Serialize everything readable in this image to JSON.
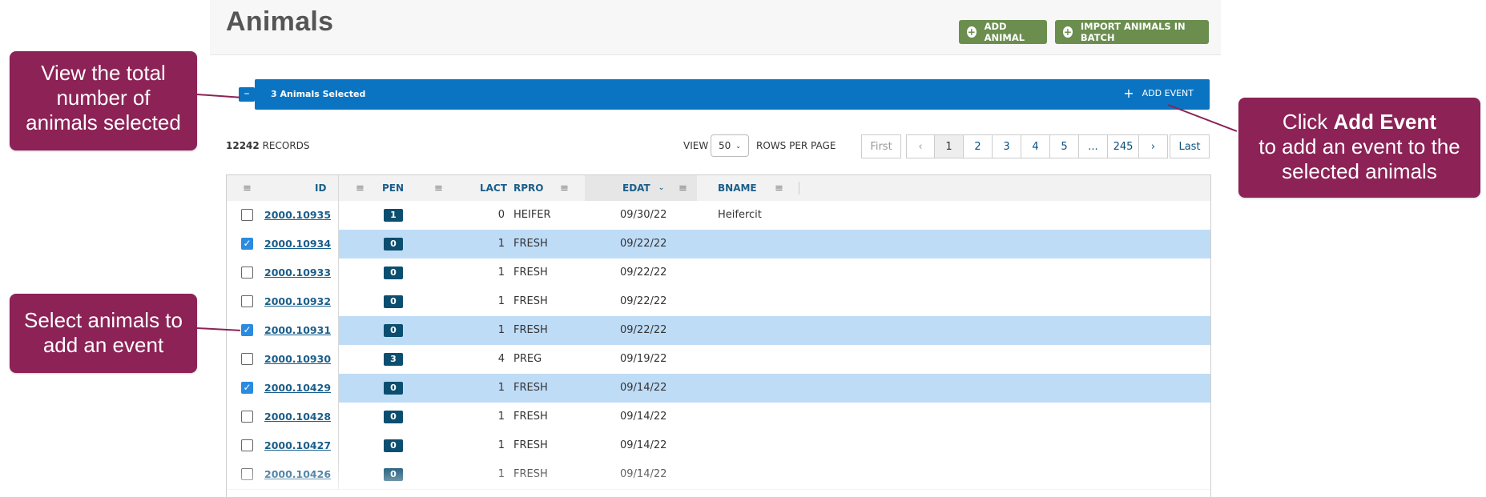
{
  "page": {
    "title": "Animals",
    "add_animal": "ADD ANIMAL",
    "import_batch": "IMPORT ANIMALS IN BATCH"
  },
  "selection": {
    "collapse": "–",
    "count_label": "3 Animals Selected",
    "add_event": "ADD EVENT"
  },
  "records": {
    "count": "12242",
    "label": "RECORDS"
  },
  "view": {
    "label": "VIEW",
    "rows": "50",
    "rows_label": "ROWS PER PAGE"
  },
  "pagination": {
    "first": "First",
    "prev": "‹",
    "pages": [
      "1",
      "2",
      "3",
      "4",
      "5",
      "...",
      "245"
    ],
    "next": "›",
    "last": "Last"
  },
  "columns": {
    "id": "ID",
    "pen": "PEN",
    "lact": "LACT",
    "rpro": "RPRO",
    "edat": "EDAT",
    "bname": "BNAME"
  },
  "rows": [
    {
      "id": "2000.10935",
      "pen": "1",
      "lact": "0",
      "rpro": "HEIFER",
      "edat": "09/30/22",
      "bname": "Heifercit",
      "selected": false
    },
    {
      "id": "2000.10934",
      "pen": "0",
      "lact": "1",
      "rpro": "FRESH",
      "edat": "09/22/22",
      "bname": "",
      "selected": true
    },
    {
      "id": "2000.10933",
      "pen": "0",
      "lact": "1",
      "rpro": "FRESH",
      "edat": "09/22/22",
      "bname": "",
      "selected": false
    },
    {
      "id": "2000.10932",
      "pen": "0",
      "lact": "1",
      "rpro": "FRESH",
      "edat": "09/22/22",
      "bname": "",
      "selected": false
    },
    {
      "id": "2000.10931",
      "pen": "0",
      "lact": "1",
      "rpro": "FRESH",
      "edat": "09/22/22",
      "bname": "",
      "selected": true
    },
    {
      "id": "2000.10930",
      "pen": "3",
      "lact": "4",
      "rpro": "PREG",
      "edat": "09/19/22",
      "bname": "",
      "selected": false
    },
    {
      "id": "2000.10429",
      "pen": "0",
      "lact": "1",
      "rpro": "FRESH",
      "edat": "09/14/22",
      "bname": "",
      "selected": true
    },
    {
      "id": "2000.10428",
      "pen": "0",
      "lact": "1",
      "rpro": "FRESH",
      "edat": "09/14/22",
      "bname": "",
      "selected": false
    },
    {
      "id": "2000.10427",
      "pen": "0",
      "lact": "1",
      "rpro": "FRESH",
      "edat": "09/14/22",
      "bname": "",
      "selected": false
    },
    {
      "id": "2000.10426",
      "pen": "0",
      "lact": "1",
      "rpro": "FRESH",
      "edat": "09/14/22",
      "bname": "",
      "selected": false
    }
  ],
  "callouts": {
    "total": [
      "View the total",
      "number of",
      "animals selected"
    ],
    "select": [
      "Select animals to",
      "add an event"
    ],
    "add_event": {
      "prefix": "Click ",
      "bold": "Add Event",
      "line2": "to add an event to the",
      "line3": "selected animals"
    }
  },
  "colors": {
    "accent": "#0a74c2",
    "callout": "#8c2256",
    "green": "#6b8e4e",
    "selected_row": "#bfdcf7"
  }
}
